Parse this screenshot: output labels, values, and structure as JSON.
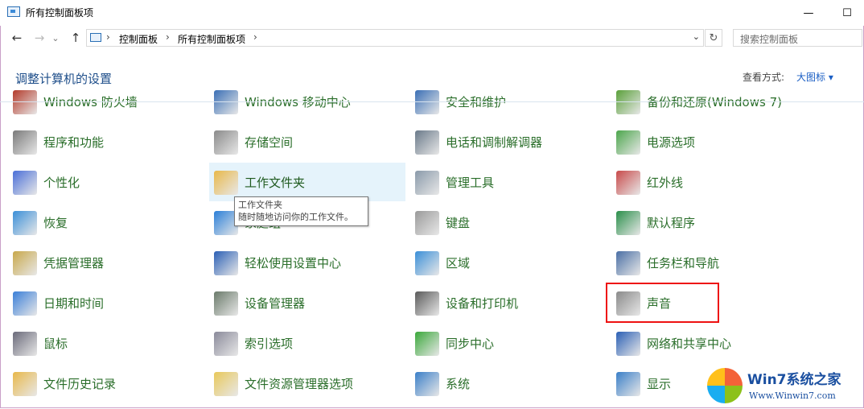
{
  "window": {
    "title": "所有控制面板项",
    "min_label": "—",
    "max_label": "☐"
  },
  "nav": {
    "back": "←",
    "forward": "→",
    "dropdown": "⌄",
    "up": "↑"
  },
  "address": {
    "crumbs": [
      "控制面板",
      "所有控制面板项"
    ],
    "sep": "›",
    "dropdown": "⌄",
    "refresh": "↻"
  },
  "search": {
    "placeholder": "搜索控制面板"
  },
  "header": {
    "title": "调整计算机的设置",
    "view_by_label": "查看方式:",
    "view_by_value": "大图标 ▾"
  },
  "items": [
    {
      "label": "Windows 防火墙",
      "icon": "firewall-icon",
      "color": "#b33a2a"
    },
    {
      "label": "Windows 移动中心",
      "icon": "mobility-center-icon",
      "color": "#3a6fb5"
    },
    {
      "label": "安全和维护",
      "icon": "security-maintenance-icon",
      "color": "#3a6fb5"
    },
    {
      "label": "备份和还原(Windows 7)",
      "icon": "backup-restore-icon",
      "color": "#5aa03a"
    },
    {
      "label": "程序和功能",
      "icon": "programs-features-icon",
      "color": "#7a7a7a"
    },
    {
      "label": "存储空间",
      "icon": "storage-spaces-icon",
      "color": "#8a8a8a"
    },
    {
      "label": "电话和调制解调器",
      "icon": "phone-modem-icon",
      "color": "#6a7a8a"
    },
    {
      "label": "电源选项",
      "icon": "power-options-icon",
      "color": "#4ca64c"
    },
    {
      "label": "个性化",
      "icon": "personalization-icon",
      "color": "#4a6fd8"
    },
    {
      "label": "工作文件夹",
      "icon": "work-folders-icon",
      "color": "#e8b84a"
    },
    {
      "label": "管理工具",
      "icon": "admin-tools-icon",
      "color": "#8a9aaa"
    },
    {
      "label": "红外线",
      "icon": "infrared-icon",
      "color": "#c84a4a"
    },
    {
      "label": "恢复",
      "icon": "recovery-icon",
      "color": "#3a8fd8"
    },
    {
      "label": "家庭组",
      "icon": "homegroup-icon",
      "color": "#2a7fd8"
    },
    {
      "label": "键盘",
      "icon": "keyboard-icon",
      "color": "#9a9a9a"
    },
    {
      "label": "默认程序",
      "icon": "default-programs-icon",
      "color": "#2a8f4a"
    },
    {
      "label": "凭据管理器",
      "icon": "credential-manager-icon",
      "color": "#c8a84a"
    },
    {
      "label": "轻松使用设置中心",
      "icon": "ease-of-access-icon",
      "color": "#2a5fb5"
    },
    {
      "label": "区域",
      "icon": "region-icon",
      "color": "#3a8fd8"
    },
    {
      "label": "任务栏和导航",
      "icon": "taskbar-navigation-icon",
      "color": "#4a6fa5"
    },
    {
      "label": "日期和时间",
      "icon": "date-time-icon",
      "color": "#3a7fd8"
    },
    {
      "label": "设备管理器",
      "icon": "device-manager-icon",
      "color": "#6a7a6a"
    },
    {
      "label": "设备和打印机",
      "icon": "devices-printers-icon",
      "color": "#5a5a5a"
    },
    {
      "label": "声音",
      "icon": "sound-icon",
      "color": "#8a8a8a"
    },
    {
      "label": "鼠标",
      "icon": "mouse-icon",
      "color": "#6a6a7a"
    },
    {
      "label": "索引选项",
      "icon": "indexing-options-icon",
      "color": "#8a8a9a"
    },
    {
      "label": "同步中心",
      "icon": "sync-center-icon",
      "color": "#3aa83a"
    },
    {
      "label": "网络和共享中心",
      "icon": "network-sharing-icon",
      "color": "#2a5fb5"
    },
    {
      "label": "文件历史记录",
      "icon": "file-history-icon",
      "color": "#e8b84a"
    },
    {
      "label": "文件资源管理器选项",
      "icon": "file-explorer-options-icon",
      "color": "#e8c85a"
    },
    {
      "label": "系统",
      "icon": "system-icon",
      "color": "#3a7fc8"
    },
    {
      "label": "显示",
      "icon": "display-icon",
      "color": "#3a7fc8"
    }
  ],
  "tooltip": {
    "title": "工作文件夹",
    "body": "随时随地访问你的工作文件。"
  },
  "watermark": {
    "title": "Win7系统之家",
    "url": "Www.Winwin7.com"
  }
}
